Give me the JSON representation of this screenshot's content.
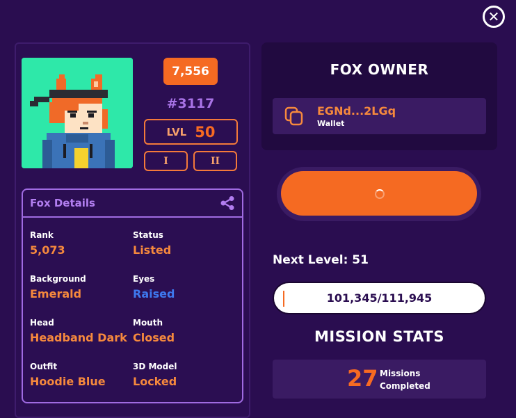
{
  "close_icon": "close-icon",
  "fox": {
    "price": "7,556",
    "token_id": "#3117",
    "level_label": "LVL",
    "level_value": "50",
    "tier_buttons": [
      "I",
      "II"
    ]
  },
  "details": {
    "title": "Fox Details",
    "share_icon": "share-icon",
    "attributes": [
      {
        "label": "Rank",
        "value": "5,073"
      },
      {
        "label": "Status",
        "value": "Listed"
      },
      {
        "label": "Background",
        "value": "Emerald"
      },
      {
        "label": "Eyes",
        "value": "Raised"
      },
      {
        "label": "Head",
        "value": "Headband Dark"
      },
      {
        "label": "Mouth",
        "value": "Closed"
      },
      {
        "label": "Outfit",
        "value": "Hoodie Blue"
      },
      {
        "label": "3D Model",
        "value": "Locked"
      }
    ]
  },
  "owner": {
    "title": "FOX OWNER",
    "wallet_address": "EGNd...2LGq",
    "wallet_label": "Wallet"
  },
  "progress": {
    "next_level_label": "Next Level: 51",
    "xp_text": "101,345/111,945",
    "xp_current": 101345,
    "xp_target": 111945
  },
  "missions": {
    "title": "MISSION STATS",
    "count": "27",
    "label_line1": "Missions",
    "label_line2": "Completed"
  },
  "colors": {
    "background": "#2a0d50",
    "accent_orange": "#f56a22",
    "accent_purple": "#a06be2",
    "avatar_bg": "#2ee8a9",
    "eyes_blue": "#3e78ee"
  }
}
